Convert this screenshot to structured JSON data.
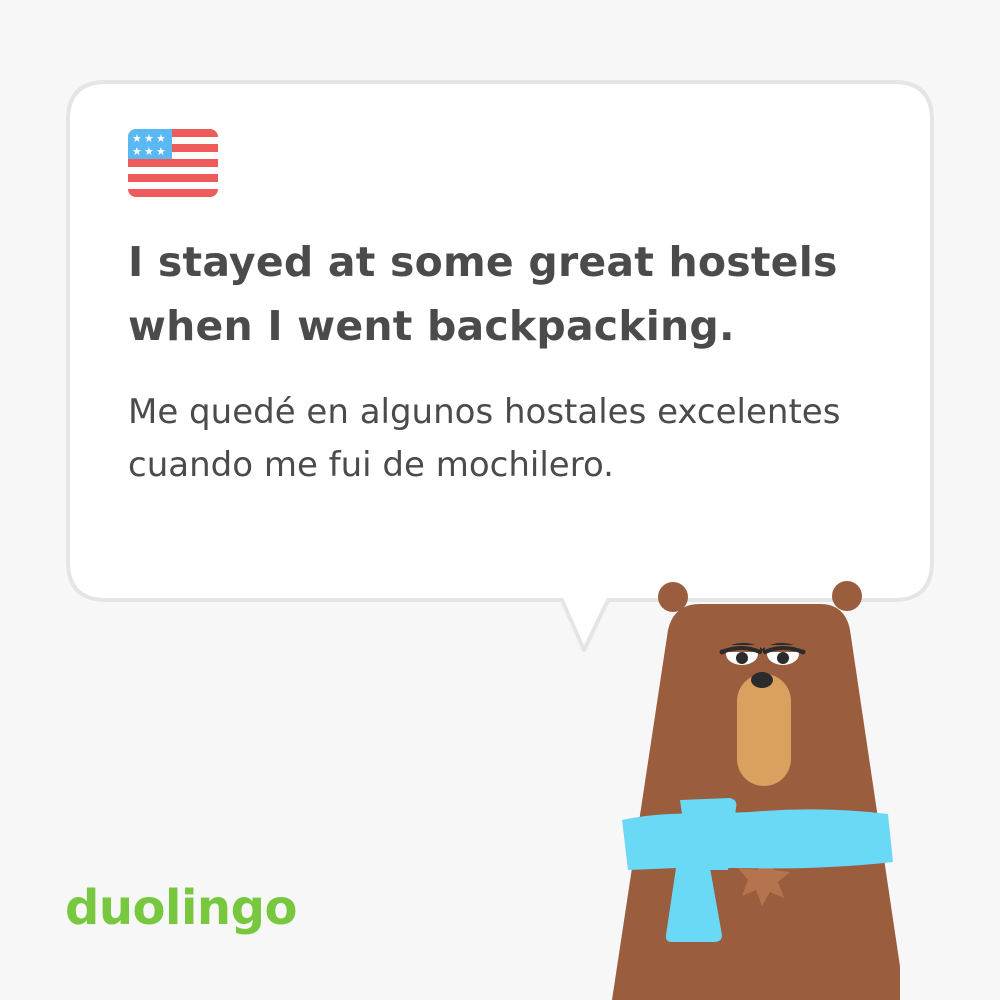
{
  "card": {
    "flag_icon": "us-flag-icon",
    "english_sentence": "I stayed at some great hostels when I went backpacking.",
    "spanish_translation": "Me quedé en algunos hostales excelentes cuando me fui de mochilero."
  },
  "brand": {
    "logo_text": "duolingo",
    "logo_color": "#77c83e"
  },
  "character": {
    "name_icon": "bear-character-icon",
    "fur_color": "#9a5e3e",
    "snout_color": "#d9a060",
    "scarf_color": "#6ad9f5"
  },
  "colors": {
    "background": "#f7f7f7",
    "bubble_fill": "#ffffff",
    "bubble_border": "#e5e5e5",
    "text": "#4b4b4b"
  }
}
